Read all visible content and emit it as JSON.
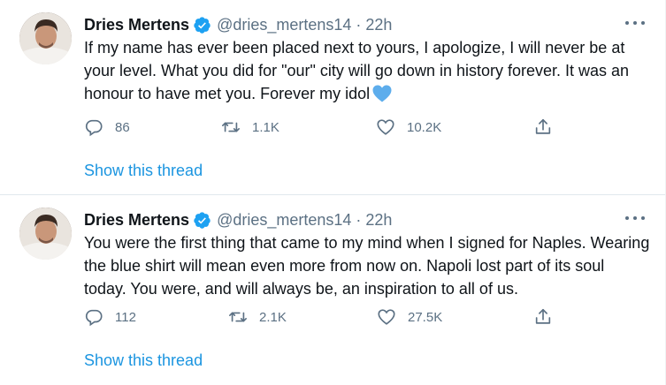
{
  "tweets": [
    {
      "author": "Dries Mertens",
      "handle": "@dries_mertens14",
      "separator": "·",
      "time": "22h",
      "text": "If my name has ever been placed next to yours, I apologize, I will never be at your level. What you did for \"our\" city will go down in history forever. It was an honour to have met you. Forever my idol",
      "emoji": "blue-heart",
      "replies": "86",
      "retweets": "1.1K",
      "likes": "10.2K",
      "show_thread": "Show this thread"
    },
    {
      "author": "Dries Mertens",
      "handle": "@dries_mertens14",
      "separator": "·",
      "time": "22h",
      "text": "You were the first thing that came to my mind when I signed for Naples. Wearing the blue shirt will mean even more from now on. Napoli lost part of its soul today. You were, and will always be, an inspiration to all of us.",
      "replies": "112",
      "retweets": "2.1K",
      "likes": "27.5K",
      "show_thread": "Show this thread"
    }
  ],
  "icons": {
    "verified": "verified-badge-icon",
    "more": "more-horizontal-icon",
    "reply": "reply-bubble-icon",
    "retweet": "retweet-icon",
    "like": "heart-outline-icon",
    "share": "share-upload-icon"
  },
  "colors": {
    "accent": "#1b95e0",
    "verified": "#1da1f2",
    "secondary_text": "#5b7083",
    "text": "#0f1419",
    "divider": "#e1e8ed",
    "emoji_heart": "#5dadec"
  }
}
